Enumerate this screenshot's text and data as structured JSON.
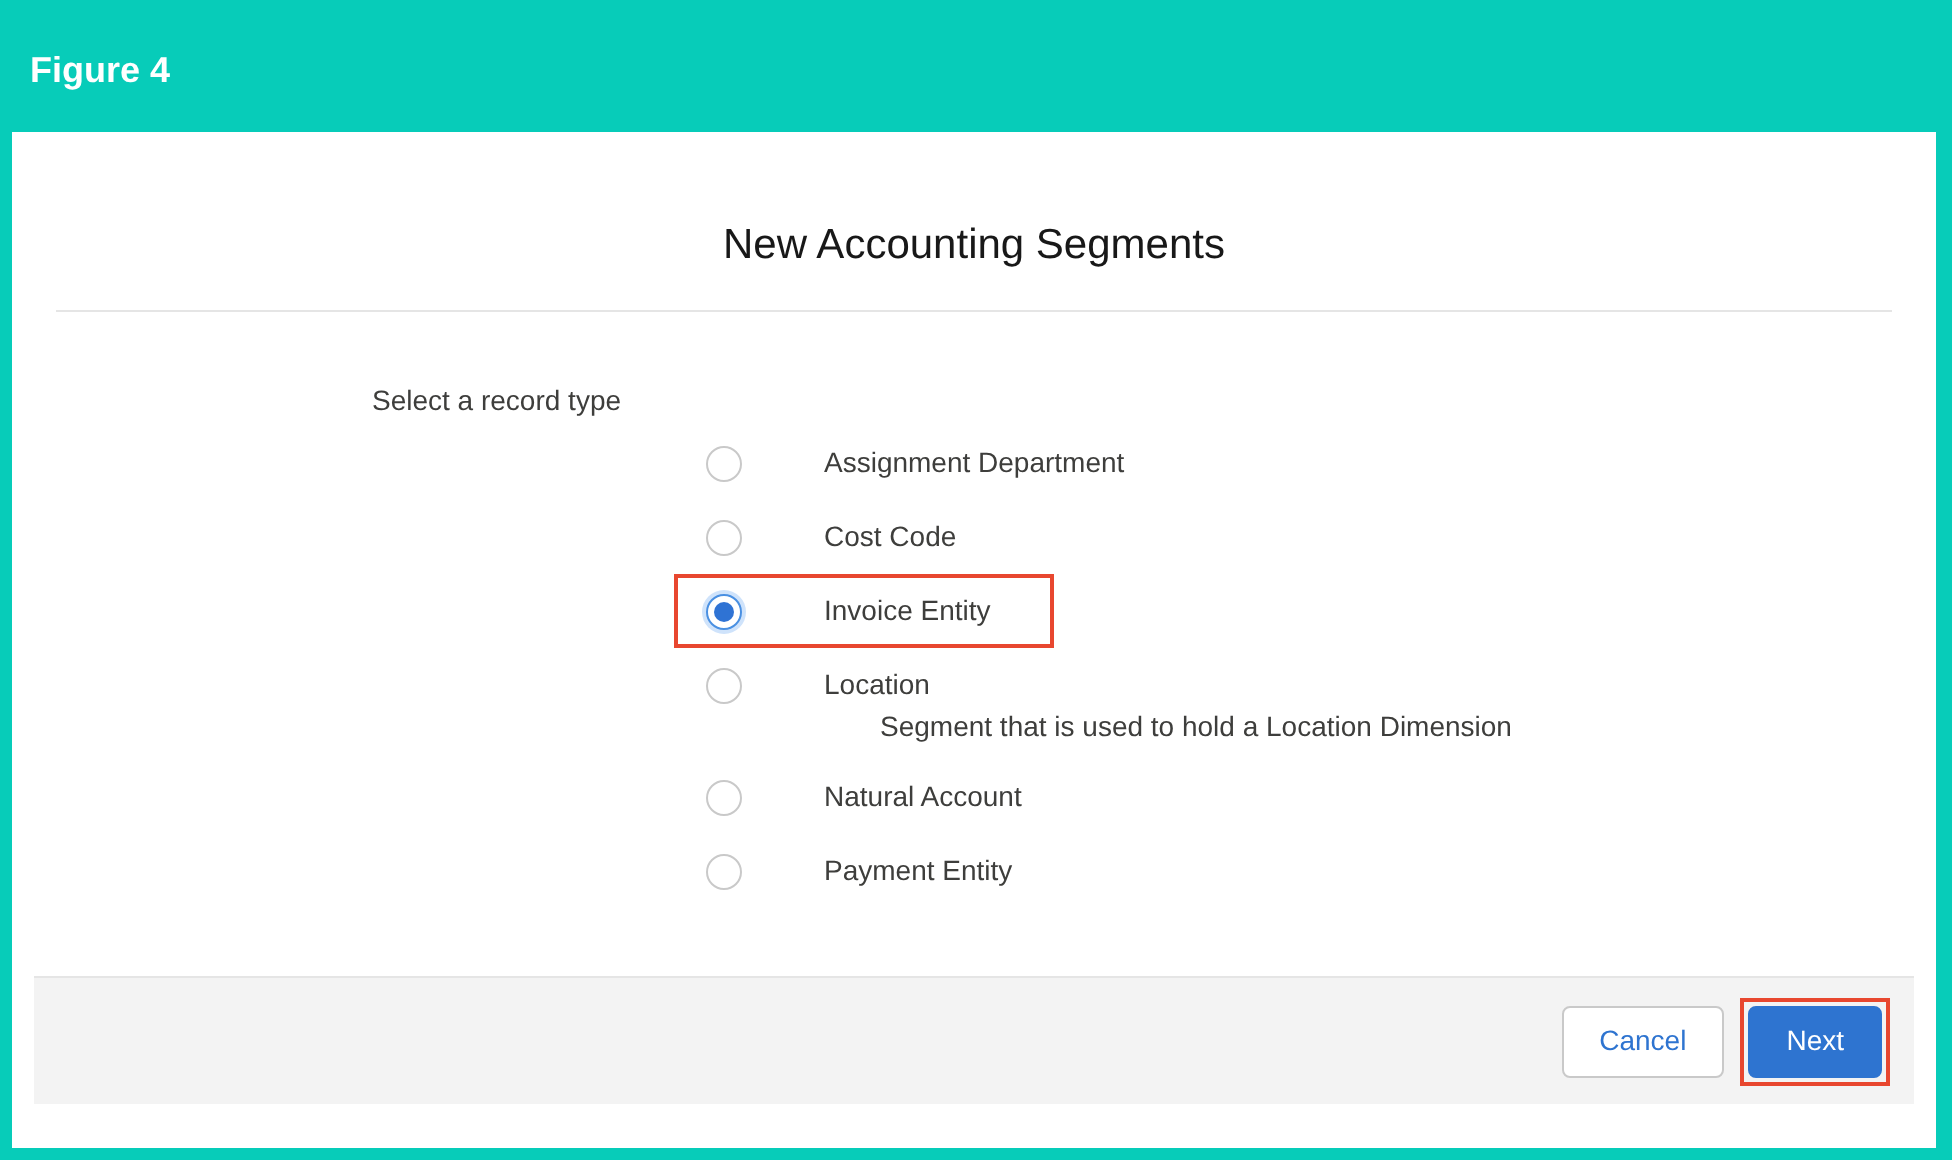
{
  "figure_label": "Figure 4",
  "dialog": {
    "title": "New Accounting Segments",
    "prompt": "Select a record type",
    "options": [
      {
        "label": "Assignment Department",
        "selected": false,
        "highlighted": false
      },
      {
        "label": "Cost Code",
        "selected": false,
        "highlighted": false
      },
      {
        "label": "Invoice Entity",
        "selected": true,
        "highlighted": true
      },
      {
        "label": "Location",
        "description": "Segment that is used to hold a Location Dimension",
        "selected": false,
        "highlighted": false
      },
      {
        "label": "Natural Account",
        "selected": false,
        "highlighted": false
      },
      {
        "label": "Payment Entity",
        "selected": false,
        "highlighted": false
      }
    ],
    "buttons": [
      {
        "label": "Cancel",
        "kind": "neutral",
        "highlighted": false
      },
      {
        "label": "Next",
        "kind": "brand",
        "highlighted": true
      }
    ]
  }
}
